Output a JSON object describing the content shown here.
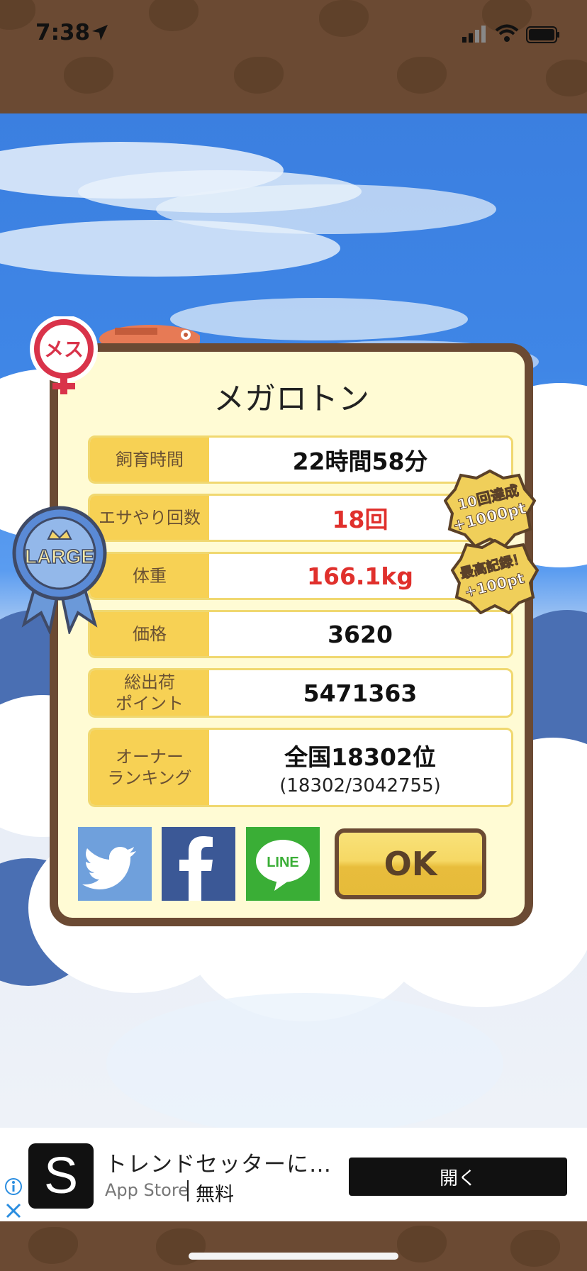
{
  "status_bar": {
    "time": "7:38"
  },
  "dialog": {
    "title": "メガロトン",
    "rows": [
      {
        "label": "飼育時間",
        "value": "22時間58分"
      },
      {
        "label": "エサやり回数",
        "value": "18回"
      },
      {
        "label": "体重",
        "value": "166.1kg"
      },
      {
        "label": "価格",
        "value": "3620"
      },
      {
        "label_line1": "総出荷",
        "label_line2": "ポイント",
        "value": "5471363"
      },
      {
        "label_line1": "オーナー",
        "label_line2": "ランキング",
        "value": "全国18302位",
        "sub": "(18302/3042755)"
      }
    ],
    "ok_label": "OK",
    "social": {
      "line_text": "LINE"
    }
  },
  "badges": {
    "gender": "メス",
    "size": "LARGE",
    "achievement1_line1": "10回達成",
    "achievement1_line2": "+1000pt",
    "achievement2_line1": "最高記録！",
    "achievement2_line2": "+100pt"
  },
  "ad": {
    "app_letter": "S",
    "title": "トレンドセッターに…",
    "store": "App Store",
    "price": "無料",
    "open_label": "開く"
  },
  "colors": {
    "brown": "#6b4a33",
    "panel": "#fffbd4",
    "label_bg": "#f7d154",
    "highlight_red": "#e0302c",
    "sky_blue": "#3b7fe0"
  }
}
